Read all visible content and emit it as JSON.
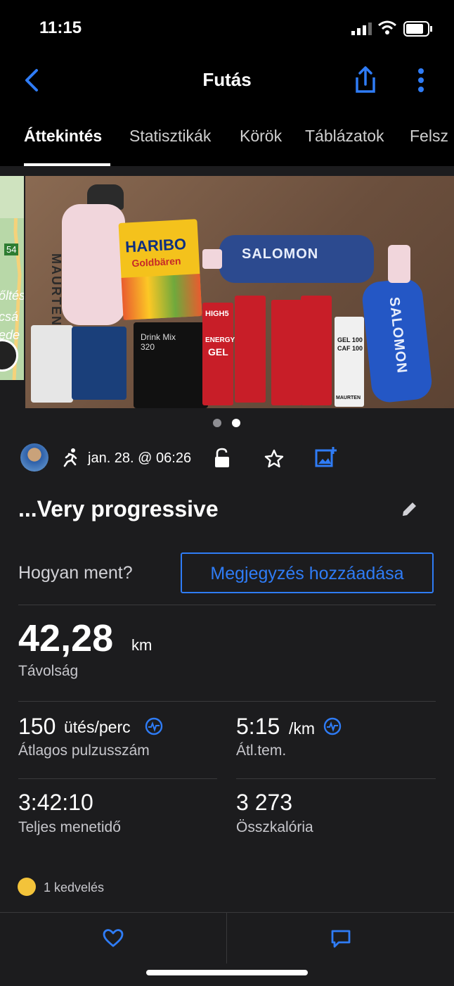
{
  "status_bar": {
    "time": "11:15"
  },
  "header": {
    "title": "Futás",
    "back_icon": "chevron-left-icon",
    "share_icon": "share-icon",
    "more_icon": "more-vertical-icon"
  },
  "tabs": [
    {
      "label": "Áttekintés",
      "active": true
    },
    {
      "label": "Statisztikák"
    },
    {
      "label": "Körök"
    },
    {
      "label": "Táblázatok"
    },
    {
      "label": "Felsz"
    }
  ],
  "gallery": {
    "map_label": "54",
    "map_text_lines": [
      "őltés",
      "csá",
      "ede"
    ],
    "photo_labels": {
      "bottle_brand": "MAURTEN",
      "haribo_brand": "HARIBO",
      "haribo_sub": "Goldbären",
      "flask_brand": "SALOMON",
      "flask_brand_2": "SALOMON",
      "drink_mix": "Drink Mix",
      "drink_mix_num": "320",
      "gel_brand": "HIGH5",
      "gel_line1": "ENERGY",
      "gel_line2": "GEL",
      "maurten_gel_line1": "GEL 100",
      "maurten_gel_line2": "CAF 100",
      "maurten_gel_brand": "MAURTEN"
    },
    "active_page_index": 1,
    "page_count": 2
  },
  "activity_meta": {
    "date": "jan. 28. @ 06:26",
    "activity_icon": "running-icon",
    "privacy_icon": "unlock-icon",
    "favorite_icon": "star-icon",
    "add_photo_icon": "add-photo-icon"
  },
  "activity": {
    "name": "...Very progressive",
    "edit_icon": "pencil-icon"
  },
  "feeling": {
    "question": "Hogyan ment?",
    "button": "Megjegyzés hozzáadása"
  },
  "distance": {
    "value": "42,28",
    "unit": "km",
    "label": "Távolság"
  },
  "stats": [
    {
      "value": "150",
      "unit": "ütés/perc",
      "label": "Átlagos pulzusszám",
      "icon": "activity-monitor-icon"
    },
    {
      "value": "5:15",
      "unit": "/km",
      "label": "Átl.tem.",
      "icon": "activity-monitor-icon"
    },
    {
      "value": "3:42:10",
      "unit": "",
      "label": "Teljes menetidő"
    },
    {
      "value": "3 273",
      "unit": "",
      "label": "Összkalória"
    }
  ],
  "likes": {
    "text": "1 kedvelés"
  },
  "bottom_bar": {
    "like_icon": "heart-icon",
    "comment_icon": "comment-icon"
  },
  "colors": {
    "background": "#1c1c1e",
    "accent": "#2f7cf6",
    "header": "#000000"
  }
}
